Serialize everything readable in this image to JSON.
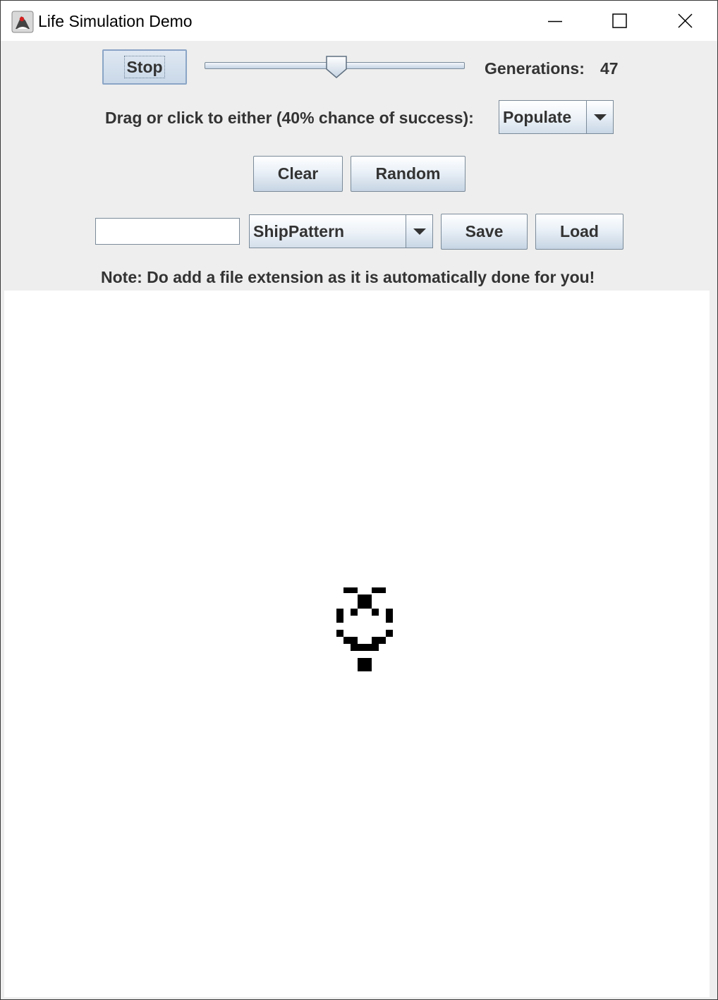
{
  "window": {
    "title": "Life Simulation Demo",
    "icon": "java-duke-icon",
    "controls": [
      "minimize-icon",
      "maximize-icon",
      "close-icon"
    ]
  },
  "toolbar": {
    "stop_label": "Stop",
    "speed_slider_level": 0.5,
    "generations_label": "Generations:",
    "generations_value": "47"
  },
  "mode": {
    "label": "Drag or click to either (40% chance of success):",
    "selected": "Populate"
  },
  "actions": {
    "clear_label": "Clear",
    "random_label": "Random"
  },
  "file": {
    "filename_value": "",
    "pattern_selected": "ShipPattern",
    "save_label": "Save",
    "load_label": "Load",
    "note": "Note: Do add a file extension as it is automatically done for you!"
  },
  "colors": {
    "panel_background": "#eeeeee",
    "canvas_background": "#ffffff",
    "live_cell": "#000000",
    "text": "#333333"
  }
}
